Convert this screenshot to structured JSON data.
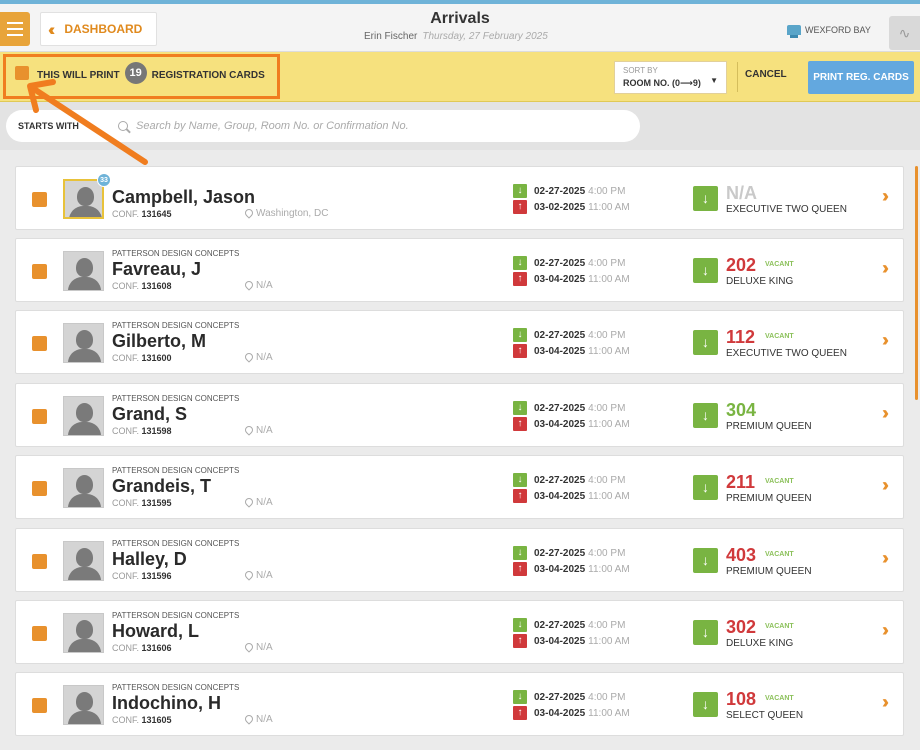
{
  "topbar": {
    "dashboard_label": "DASHBOARD",
    "title": "Arrivals",
    "user": "Erin Fischer",
    "date": "Thursday, 27 February 2025",
    "hotel": "WEXFORD BAY"
  },
  "printbar": {
    "prefix": "THIS WILL PRINT",
    "count": "19",
    "suffix": "REGISTRATION CARDS",
    "sort_label": "SORT BY",
    "sort_value": "ROOM NO. (0⟶9)",
    "cancel_label": "CANCEL",
    "print_label": "PRINT REG. CARDS"
  },
  "search": {
    "starts_with": "STARTS WITH",
    "placeholder": "Search by Name, Group, Room No. or Confirmation No."
  },
  "reservations": [
    {
      "company": "",
      "name": "Campbell, Jason",
      "conf_label": "CONF.",
      "conf": "131645",
      "location": "Washington, DC",
      "arrive_date": "02-27-2025",
      "arrive_time": "4:00 PM",
      "depart_date": "03-02-2025",
      "depart_time": "11:00 AM",
      "room": "N/A",
      "room_status": "",
      "room_type": "EXECUTIVE TWO QUEEN",
      "avatar_badge": "33"
    },
    {
      "company": "PATTERSON DESIGN CONCEPTS",
      "name": "Favreau, J",
      "conf_label": "CONF.",
      "conf": "131608",
      "location": "N/A",
      "arrive_date": "02-27-2025",
      "arrive_time": "4:00 PM",
      "depart_date": "03-04-2025",
      "depart_time": "11:00 AM",
      "room": "202",
      "room_status": "VACANT",
      "room_type": "DELUXE KING"
    },
    {
      "company": "PATTERSON DESIGN CONCEPTS",
      "name": "Gilberto, M",
      "conf_label": "CONF.",
      "conf": "131600",
      "location": "N/A",
      "arrive_date": "02-27-2025",
      "arrive_time": "4:00 PM",
      "depart_date": "03-04-2025",
      "depart_time": "11:00 AM",
      "room": "112",
      "room_status": "VACANT",
      "room_type": "EXECUTIVE TWO QUEEN"
    },
    {
      "company": "PATTERSON DESIGN CONCEPTS",
      "name": "Grand, S",
      "conf_label": "CONF.",
      "conf": "131598",
      "location": "N/A",
      "arrive_date": "02-27-2025",
      "arrive_time": "4:00 PM",
      "depart_date": "03-04-2025",
      "depart_time": "11:00 AM",
      "room": "304",
      "room_status": "",
      "room_type": "PREMIUM QUEEN"
    },
    {
      "company": "PATTERSON DESIGN CONCEPTS",
      "name": "Grandeis, T",
      "conf_label": "CONF.",
      "conf": "131595",
      "location": "N/A",
      "arrive_date": "02-27-2025",
      "arrive_time": "4:00 PM",
      "depart_date": "03-04-2025",
      "depart_time": "11:00 AM",
      "room": "211",
      "room_status": "VACANT",
      "room_type": "PREMIUM QUEEN"
    },
    {
      "company": "PATTERSON DESIGN CONCEPTS",
      "name": "Halley, D",
      "conf_label": "CONF.",
      "conf": "131596",
      "location": "N/A",
      "arrive_date": "02-27-2025",
      "arrive_time": "4:00 PM",
      "depart_date": "03-04-2025",
      "depart_time": "11:00 AM",
      "room": "403",
      "room_status": "VACANT",
      "room_type": "PREMIUM QUEEN"
    },
    {
      "company": "PATTERSON DESIGN CONCEPTS",
      "name": "Howard, L",
      "conf_label": "CONF.",
      "conf": "131606",
      "location": "N/A",
      "arrive_date": "02-27-2025",
      "arrive_time": "4:00 PM",
      "depart_date": "03-04-2025",
      "depart_time": "11:00 AM",
      "room": "302",
      "room_status": "VACANT",
      "room_type": "DELUXE KING"
    },
    {
      "company": "PATTERSON DESIGN CONCEPTS",
      "name": "Indochino, H",
      "conf_label": "CONF.",
      "conf": "131605",
      "location": "N/A",
      "arrive_date": "02-27-2025",
      "arrive_time": "4:00 PM",
      "depart_date": "03-04-2025",
      "depart_time": "11:00 AM",
      "room": "108",
      "room_status": "VACANT",
      "room_type": "SELECT QUEEN"
    }
  ],
  "colors": {
    "accent": "#e8912d",
    "printbar": "#f6e17e",
    "highlight": "#f07d1f",
    "vacant": "#d0393b",
    "clean": "#79b442",
    "print_button": "#63a8df"
  }
}
